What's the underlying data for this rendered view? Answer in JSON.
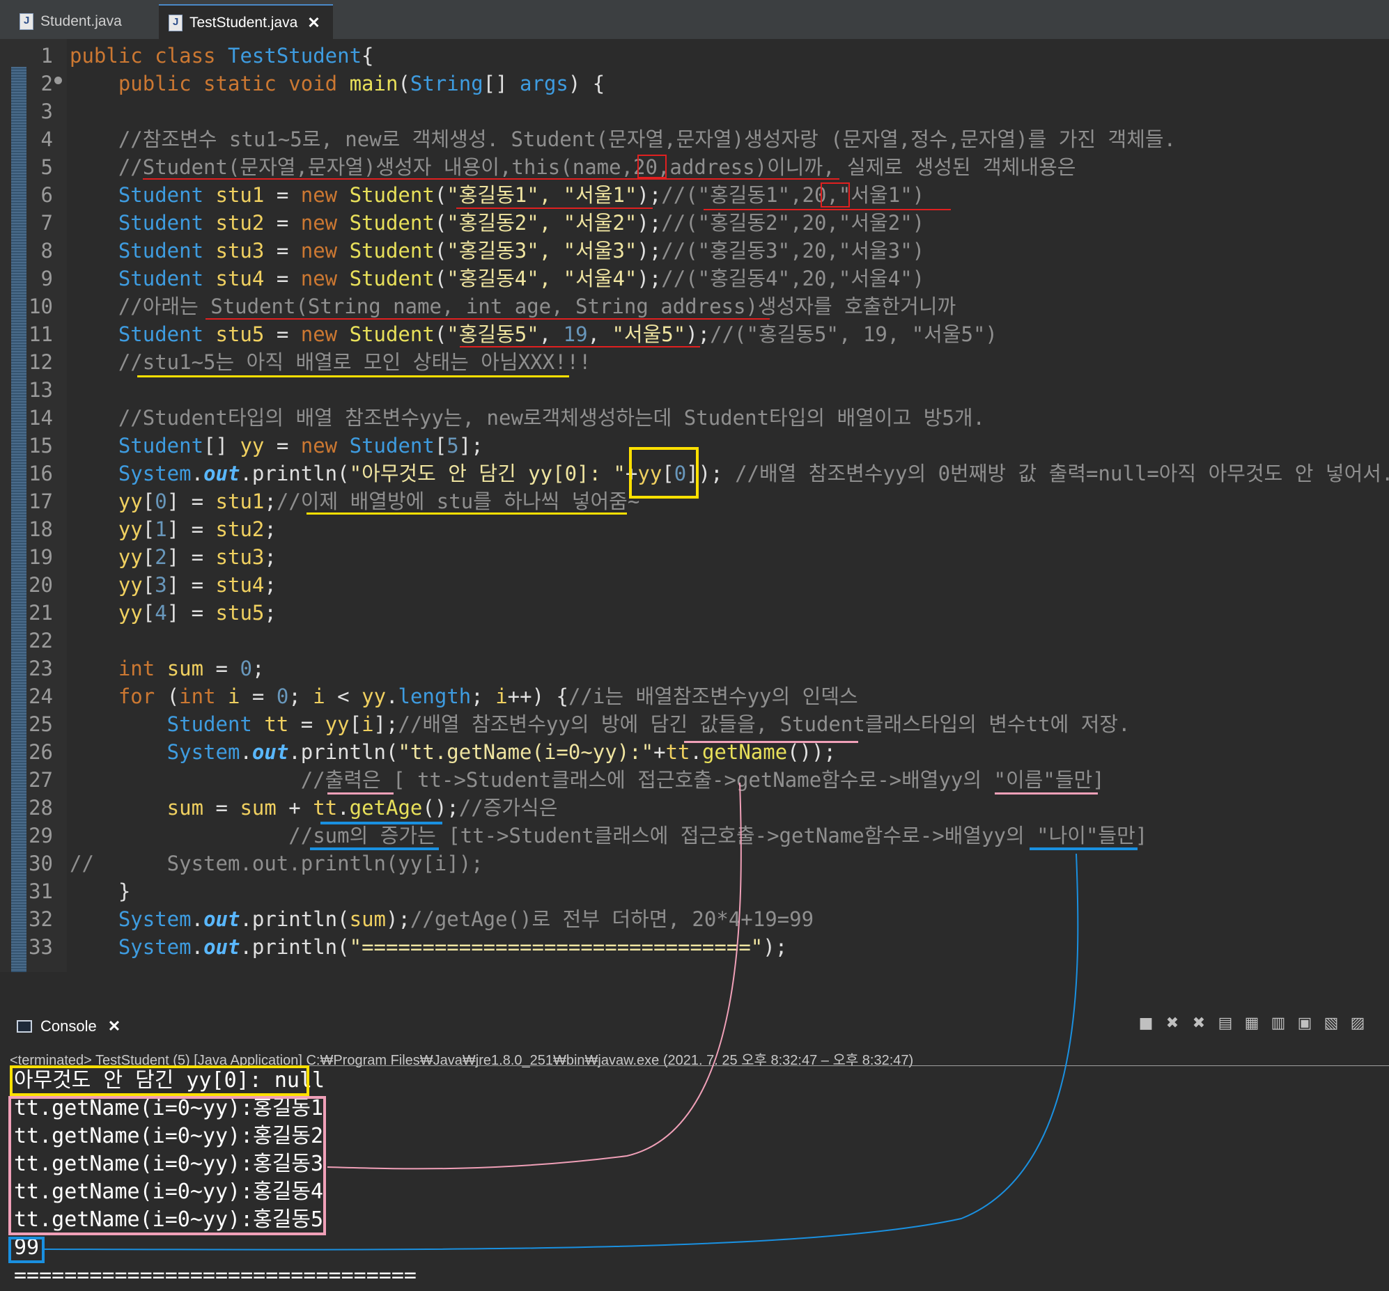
{
  "tabs": [
    {
      "label": "Student.java",
      "active": false
    },
    {
      "label": "TestStudent.java",
      "active": true,
      "close": "✕"
    }
  ],
  "editor": {
    "line_numbers": [
      "1",
      "2",
      "3",
      "4",
      "5",
      "6",
      "7",
      "8",
      "9",
      "10",
      "11",
      "12",
      "13",
      "14",
      "15",
      "16",
      "17",
      "18",
      "19",
      "20",
      "21",
      "22",
      "23",
      "24",
      "25",
      "26",
      "27",
      "28",
      "29",
      "30",
      "31",
      "32",
      "33"
    ],
    "lines": [
      {
        "segs": [
          [
            "kw",
            "public class "
          ],
          [
            "ty",
            "TestStudent"
          ],
          [
            "",
            "{"
          ]
        ]
      },
      {
        "segs": [
          [
            "kw",
            "    public static void "
          ],
          [
            "mth",
            "main"
          ],
          [
            "",
            "("
          ],
          [
            "ty",
            "String"
          ],
          [
            "",
            "[] "
          ],
          [
            "ty",
            "args"
          ],
          [
            "",
            ") {"
          ]
        ]
      },
      {
        "segs": []
      },
      {
        "segs": [
          [
            "cm",
            "    //참조변수 stu1~5로, new로 객체생성. Student(문자열,문자열)생성자랑 (문자열,정수,문자열)를 가진 객체들."
          ]
        ]
      },
      {
        "segs": [
          [
            "cm",
            "    //Student(문자열,문자열)생성자 내용이,this(name,20,address)이니까, 실제로 생성된 객체내용은"
          ]
        ]
      },
      {
        "segs": [
          [
            "ty",
            "    Student "
          ],
          [
            "var",
            "stu1"
          ],
          [
            "",
            " = "
          ],
          [
            "kw",
            "new "
          ],
          [
            "mth",
            "Student"
          ],
          [
            "",
            "("
          ],
          [
            "str",
            "\"홍길동1\", \"서울1\""
          ],
          [
            "",
            ");"
          ],
          [
            "cm",
            "//(\"홍길동1\",20,\"서울1\")"
          ]
        ]
      },
      {
        "segs": [
          [
            "ty",
            "    Student "
          ],
          [
            "var",
            "stu2"
          ],
          [
            "",
            " = "
          ],
          [
            "kw",
            "new "
          ],
          [
            "mth",
            "Student"
          ],
          [
            "",
            "("
          ],
          [
            "str",
            "\"홍길동2\", \"서울2\""
          ],
          [
            "",
            ");"
          ],
          [
            "cm",
            "//(\"홍길동2\",20,\"서울2\")"
          ]
        ]
      },
      {
        "segs": [
          [
            "ty",
            "    Student "
          ],
          [
            "var",
            "stu3"
          ],
          [
            "",
            " = "
          ],
          [
            "kw",
            "new "
          ],
          [
            "mth",
            "Student"
          ],
          [
            "",
            "("
          ],
          [
            "str",
            "\"홍길동3\", \"서울3\""
          ],
          [
            "",
            ");"
          ],
          [
            "cm",
            "//(\"홍길동3\",20,\"서울3\")"
          ]
        ]
      },
      {
        "segs": [
          [
            "ty",
            "    Student "
          ],
          [
            "var",
            "stu4"
          ],
          [
            "",
            " = "
          ],
          [
            "kw",
            "new "
          ],
          [
            "mth",
            "Student"
          ],
          [
            "",
            "("
          ],
          [
            "str",
            "\"홍길동4\", \"서울4\""
          ],
          [
            "",
            ");"
          ],
          [
            "cm",
            "//(\"홍길동4\",20,\"서울4\")"
          ]
        ]
      },
      {
        "segs": [
          [
            "cm",
            "    //아래는 Student(String name, int age, String address)생성자를 호출한거니까"
          ]
        ]
      },
      {
        "segs": [
          [
            "ty",
            "    Student "
          ],
          [
            "var",
            "stu5"
          ],
          [
            "",
            " = "
          ],
          [
            "kw",
            "new "
          ],
          [
            "mth",
            "Student"
          ],
          [
            "",
            "("
          ],
          [
            "str",
            "\"홍길동5\""
          ],
          [
            "",
            ", "
          ],
          [
            "num",
            "19"
          ],
          [
            "",
            ", "
          ],
          [
            "str",
            "\"서울5\""
          ],
          [
            "",
            ");"
          ],
          [
            "cm",
            "//(\"홍길동5\", 19, \"서울5\")"
          ]
        ]
      },
      {
        "segs": [
          [
            "cm",
            "    //stu1~5는 아직 배열로 모인 상태는 아님XXX!!!"
          ]
        ]
      },
      {
        "segs": []
      },
      {
        "segs": [
          [
            "cm",
            "    //Student타입의 배열 참조변수yy는, new로객체생성하는데 Student타입의 배열이고 방5개."
          ]
        ]
      },
      {
        "segs": [
          [
            "ty",
            "    Student"
          ],
          [
            "",
            "[] "
          ],
          [
            "var",
            "yy"
          ],
          [
            "",
            " = "
          ],
          [
            "kw",
            "new "
          ],
          [
            "ty",
            "Student"
          ],
          [
            "",
            "["
          ],
          [
            "num",
            "5"
          ],
          [
            "",
            "];"
          ]
        ]
      },
      {
        "segs": [
          [
            "ty",
            "    System"
          ],
          [
            "",
            "."
          ],
          [
            "fld",
            "out"
          ],
          [
            "",
            ".println("
          ],
          [
            "str",
            "\"아무것도 안 담긴 yy[0]: \""
          ],
          [
            "",
            "+"
          ],
          [
            "var",
            "yy"
          ],
          [
            "",
            "["
          ],
          [
            "num",
            "0"
          ],
          [
            "",
            "]); "
          ],
          [
            "cm",
            "//배열 참조변수yy의 0번째방 값 출력=null=아직 아무것도 안 넣어서."
          ]
        ]
      },
      {
        "segs": [
          [
            "var",
            "    yy"
          ],
          [
            "",
            "["
          ],
          [
            "num",
            "0"
          ],
          [
            "",
            "] = "
          ],
          [
            "var",
            "stu1"
          ],
          [
            "",
            ";"
          ],
          [
            "cm",
            "//이제 배열방에 stu를 하나씩 넣어줌~"
          ]
        ]
      },
      {
        "segs": [
          [
            "var",
            "    yy"
          ],
          [
            "",
            "["
          ],
          [
            "num",
            "1"
          ],
          [
            "",
            "] = "
          ],
          [
            "var",
            "stu2"
          ],
          [
            "",
            ";"
          ]
        ]
      },
      {
        "segs": [
          [
            "var",
            "    yy"
          ],
          [
            "",
            "["
          ],
          [
            "num",
            "2"
          ],
          [
            "",
            "] = "
          ],
          [
            "var",
            "stu3"
          ],
          [
            "",
            ";"
          ]
        ]
      },
      {
        "segs": [
          [
            "var",
            "    yy"
          ],
          [
            "",
            "["
          ],
          [
            "num",
            "3"
          ],
          [
            "",
            "] = "
          ],
          [
            "var",
            "stu4"
          ],
          [
            "",
            ";"
          ]
        ]
      },
      {
        "segs": [
          [
            "var",
            "    yy"
          ],
          [
            "",
            "["
          ],
          [
            "num",
            "4"
          ],
          [
            "",
            "] = "
          ],
          [
            "var",
            "stu5"
          ],
          [
            "",
            ";"
          ]
        ]
      },
      {
        "segs": []
      },
      {
        "segs": [
          [
            "kw",
            "    int "
          ],
          [
            "var",
            "sum"
          ],
          [
            "",
            " = "
          ],
          [
            "num",
            "0"
          ],
          [
            "",
            ";"
          ]
        ]
      },
      {
        "segs": [
          [
            "kw",
            "    for "
          ],
          [
            "",
            "("
          ],
          [
            "kw",
            "int "
          ],
          [
            "var",
            "i"
          ],
          [
            "",
            " = "
          ],
          [
            "num",
            "0"
          ],
          [
            "",
            "; "
          ],
          [
            "var",
            "i"
          ],
          [
            "",
            " < "
          ],
          [
            "var",
            "yy"
          ],
          [
            "",
            "."
          ],
          [
            "ty",
            "length"
          ],
          [
            "",
            "; "
          ],
          [
            "var",
            "i"
          ],
          [
            "",
            "++) {"
          ],
          [
            "cm",
            "//i는 배열참조변수yy의 인덱스"
          ]
        ]
      },
      {
        "segs": [
          [
            "ty",
            "        Student "
          ],
          [
            "var",
            "tt"
          ],
          [
            "",
            " = "
          ],
          [
            "var",
            "yy"
          ],
          [
            "",
            "["
          ],
          [
            "var",
            "i"
          ],
          [
            "",
            "];"
          ],
          [
            "cm",
            "//배열 참조변수yy의 방에 담긴 값들을, Student클래스타입의 변수tt에 저장."
          ]
        ]
      },
      {
        "segs": [
          [
            "ty",
            "        System"
          ],
          [
            "",
            "."
          ],
          [
            "fld",
            "out"
          ],
          [
            "",
            ".println("
          ],
          [
            "str",
            "\"tt.getName(i=0~yy):\""
          ],
          [
            "",
            "+"
          ],
          [
            "var",
            "tt"
          ],
          [
            "",
            "."
          ],
          [
            "mth",
            "getName"
          ],
          [
            "",
            "());"
          ]
        ]
      },
      {
        "segs": [
          [
            "cm",
            "                   //출력은 [ tt->Student클래스에 접근호출->getName함수로->배열yy의 \"이름\"들만]"
          ]
        ]
      },
      {
        "segs": [
          [
            "var",
            "        sum"
          ],
          [
            "",
            " = "
          ],
          [
            "var",
            "sum"
          ],
          [
            "",
            " + "
          ],
          [
            "var",
            "tt"
          ],
          [
            "",
            "."
          ],
          [
            "mth",
            "getAge"
          ],
          [
            "",
            "();"
          ],
          [
            "cm",
            "//증가식은"
          ]
        ]
      },
      {
        "segs": [
          [
            "cm",
            "                  //sum의 증가는 [tt->Student클래스에 접근호출->getName함수로->배열yy의 \"나이\"들만]"
          ]
        ]
      },
      {
        "segs": [
          [
            "cm",
            "//      System.out.println(yy[i]);"
          ]
        ]
      },
      {
        "segs": [
          [
            "",
            "    }"
          ]
        ]
      },
      {
        "segs": [
          [
            "ty",
            "    System"
          ],
          [
            "",
            "."
          ],
          [
            "fld",
            "out"
          ],
          [
            "",
            ".println("
          ],
          [
            "var",
            "sum"
          ],
          [
            "",
            ");"
          ],
          [
            "cm",
            "//getAge()로 전부 더하면, 20*4+19=99"
          ]
        ]
      },
      {
        "segs": [
          [
            "ty",
            "    System"
          ],
          [
            "",
            "."
          ],
          [
            "fld",
            "out"
          ],
          [
            "",
            ".println("
          ],
          [
            "str",
            "\"================================\""
          ],
          [
            "",
            ");"
          ]
        ]
      }
    ],
    "hscroll_arrow": "<"
  },
  "console": {
    "tab_label": "Console",
    "tab_close": "✕",
    "toolbar_icons": [
      "stop-icon",
      "remove-launch-icon",
      "remove-all-icon",
      "clear-console-icon",
      "scroll-lock-icon",
      "word-wrap-icon",
      "pin-console-icon",
      "display-selected-console-icon",
      "open-console-icon"
    ],
    "status": "<terminated> TestStudent (5) [Java Application] C:₩Program Files₩Java₩jre1.8.0_251₩bin₩javaw.exe  (2021. 7. 25 오후 8:32:47 – 오후 8:32:47)",
    "output": [
      "아무것도 안 담긴 yy[0]: null",
      "tt.getName(i=0~yy):홍길동1",
      "tt.getName(i=0~yy):홍길동2",
      "tt.getName(i=0~yy):홍길동3",
      "tt.getName(i=0~yy):홍길동4",
      "tt.getName(i=0~yy):홍길동5",
      "99",
      "================================"
    ]
  },
  "colors": {
    "annotation_red": "#e02020",
    "annotation_yellow": "#ffe000",
    "annotation_pink": "#f0a0b8",
    "annotation_blue": "#1a90e0"
  }
}
